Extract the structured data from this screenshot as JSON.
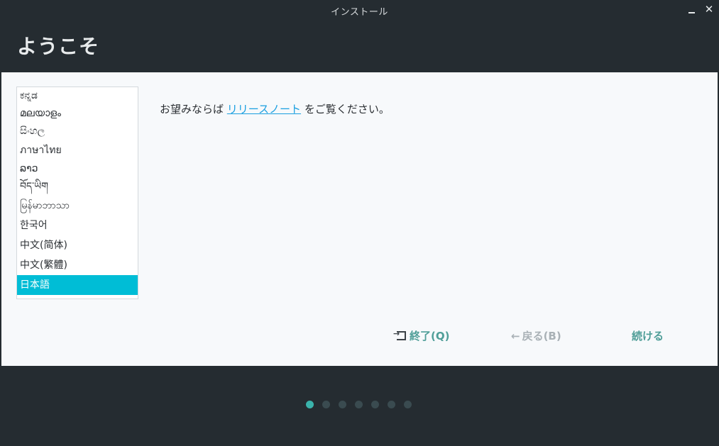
{
  "window": {
    "title": "インストール",
    "controls": {
      "minimize": "",
      "close": "✕"
    }
  },
  "header": {
    "title": "ようこそ"
  },
  "languages": [
    "ಕನ್ನಡ",
    "മലയാളം",
    "සිංහල",
    "ภาษาไทย",
    "ລາວ",
    "བོད་ཡིག",
    "မြန်မာဘာသာ",
    "한국어",
    "中文(简体)",
    "中文(繁體)",
    "日本語"
  ],
  "selected_language": "日本語",
  "message": {
    "prefix": "お望みならば ",
    "link": "リリースノート",
    "suffix": " をご覧ください。"
  },
  "buttons": {
    "quit": "終了(Q)",
    "back": "戻る(B)",
    "next": "続ける",
    "back_arrow": "←"
  },
  "progress": {
    "total_steps": 7,
    "current_step": 1
  },
  "colors": {
    "accent": "#00bdd6",
    "button_text": "#4f9e98",
    "disabled_text": "#a9b1b6",
    "dark_bg": "#252c31"
  }
}
